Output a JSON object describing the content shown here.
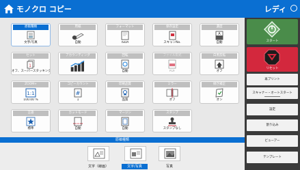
{
  "header": {
    "title": "モノクロ コピー",
    "status": "レディ"
  },
  "tiles": [
    {
      "id": "genkou",
      "title": "原稿種類",
      "value": "文字/写真",
      "icon": "document-type-icon",
      "selected": true
    },
    {
      "id": "yoshi",
      "title": "用紙",
      "value": "自動",
      "icon": "paper-roll-icon"
    },
    {
      "id": "format",
      "title": "フォーマット",
      "value": "ISOA",
      "icon": "format-icon"
    },
    {
      "id": "hozon",
      "title": "保存設定",
      "value": "スキャンNo.",
      "icon": "save-file-icon"
    },
    {
      "id": "nodo",
      "title": "濃度",
      "value": "自動",
      "icon": "density-icon"
    },
    {
      "id": "set",
      "title": "セット",
      "value": "オフ、スーパースタッキング",
      "icon": "set-stack-icon"
    },
    {
      "id": "accounting",
      "title": "アカウンティング",
      "value": "",
      "icon": "accounting-chart-icon"
    },
    {
      "id": "kaiten",
      "title": "回転",
      "value": "自動",
      "icon": "rotate-icon"
    },
    {
      "id": "file_type",
      "title": "ファイル形式",
      "value": "PDF",
      "icon": "pdf-file-icon",
      "disabled": true
    },
    {
      "id": "kurojiro",
      "title": "白黒反転",
      "value": "オフ",
      "icon": "invert-icon"
    },
    {
      "id": "zoom",
      "title": "ZOOM+",
      "value": "100.00 %",
      "icon": "zoom-1to1-icon"
    },
    {
      "id": "copies",
      "title": "コピーカウント",
      "value": "1",
      "icon": "copy-count-icon"
    },
    {
      "id": "quality",
      "title": "印刷品質",
      "value": "品質",
      "icon": "print-quality-icon"
    },
    {
      "id": "mirror",
      "title": "ミラー",
      "value": "オフ",
      "icon": "mirror-icon"
    },
    {
      "id": "skew",
      "title": "傾き補正",
      "value": "オン",
      "icon": "skew-correction-icon"
    },
    {
      "id": "preset",
      "title": "言語",
      "value": "標準",
      "icon": "star-icon"
    },
    {
      "id": "cut_mode",
      "title": "カットモード",
      "value": "自動",
      "icon": "cut-mode-icon"
    },
    {
      "id": "margin",
      "title": "マージン",
      "value": "自動",
      "icon": "margin-icon"
    },
    {
      "id": "stamp",
      "title": "スタンプ",
      "value": "スタンプなし",
      "icon": "stamp-icon"
    }
  ],
  "original_type": {
    "bar_label": "原稿種類",
    "options": [
      {
        "label": "文字（線画）",
        "icon": "text-line-art-icon",
        "selected": false
      },
      {
        "label": "文字/写真",
        "icon": "text-photo-icon",
        "selected": true
      },
      {
        "label": "写真",
        "icon": "photo-icon",
        "selected": false
      }
    ]
  },
  "sidebar": {
    "start": "スタート",
    "reset": "リセット",
    "buttons": [
      "再プリント",
      "スキャナー・オートスタート",
      "設定",
      "割り込み",
      "ビューアー",
      "テンプレート"
    ]
  },
  "colors": {
    "accent": "#0a6fd2",
    "start": "#4a8c4a",
    "reset": "#d3283d"
  }
}
